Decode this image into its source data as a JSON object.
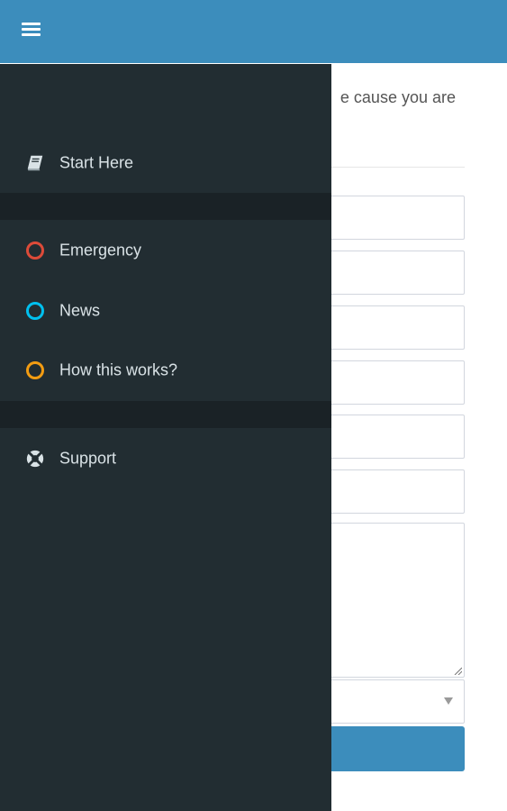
{
  "header": {
    "menu_icon": "hamburger-icon",
    "color": "#3c8dbc"
  },
  "content": {
    "intro_text": "e cause you are",
    "select_caret_icon": "caret-down-icon",
    "submit_color": "#3c8dbc"
  },
  "drawer": {
    "background": "#222d32",
    "items": [
      {
        "label": "Start Here",
        "icon": "book-icon"
      },
      {
        "label": "Emergency",
        "icon": "circle-icon",
        "color": "#dd4b39"
      },
      {
        "label": "News",
        "icon": "circle-icon",
        "color": "#00c0ef"
      },
      {
        "label": "How this works?",
        "icon": "circle-icon",
        "color": "#f39c12"
      },
      {
        "label": "Support",
        "icon": "life-ring-icon"
      }
    ]
  }
}
